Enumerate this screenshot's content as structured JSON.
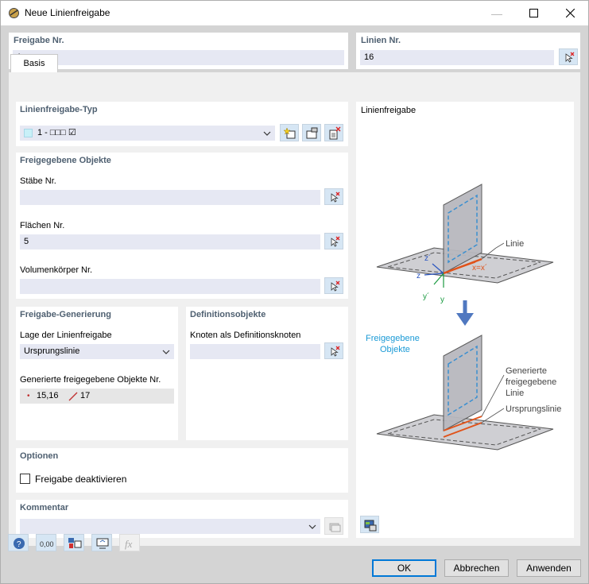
{
  "window": {
    "title": "Neue Linienfreigabe",
    "min_icon": "minimize-icon",
    "max_icon": "maximize-icon",
    "close_icon": "close-icon"
  },
  "header": {
    "release_no_label": "Freigabe Nr.",
    "release_no_value": "1",
    "lines_no_label": "Linien Nr.",
    "lines_no_value": "16"
  },
  "tabs": [
    {
      "label": "Basis"
    }
  ],
  "type_section": {
    "label": "Linienfreigabe-Typ",
    "value": "1 - □□□ ☑"
  },
  "objects_section": {
    "label": "Freigegebene Objekte",
    "members_label": "Stäbe Nr.",
    "members_value": "",
    "surfaces_label": "Flächen Nr.",
    "surfaces_value": "5",
    "solids_label": "Volumenkörper Nr.",
    "solids_value": ""
  },
  "generation_section": {
    "label": "Freigabe-Generierung",
    "position_label": "Lage der Linienfreigabe",
    "position_value": "Ursprungslinie",
    "generated_label": "Generierte freigegebene Objekte Nr.",
    "generated_nodes": "15,16",
    "generated_lines": "17"
  },
  "definition_section": {
    "label": "Definitionsobjekte",
    "nodes_label": "Knoten als Definitionsknoten",
    "nodes_value": ""
  },
  "options_section": {
    "label": "Optionen",
    "deactivate_label": "Freigabe deaktivieren",
    "deactivate_checked": false
  },
  "comment_section": {
    "label": "Kommentar",
    "value": ""
  },
  "diagram": {
    "title": "Linienfreigabe",
    "label_linie": "Linie",
    "label_xx": "x=x´",
    "label_z1": "z´",
    "label_z": "z",
    "label_y1": "y´",
    "label_y": "y",
    "label_released_line1": "Freigegebene",
    "label_released_line2": "Objekte",
    "label_generated_line1": "Generierte",
    "label_generated_line2": "freigegebene",
    "label_generated_line3": "Linie",
    "label_origin": "Ursprungslinie",
    "accent_blue": "#1a9ad6",
    "accent_orange": "#e0531a",
    "arrow_blue": "#5078c0"
  },
  "footer": {
    "ok_label": "OK",
    "cancel_label": "Abbrechen",
    "apply_label": "Anwenden"
  }
}
